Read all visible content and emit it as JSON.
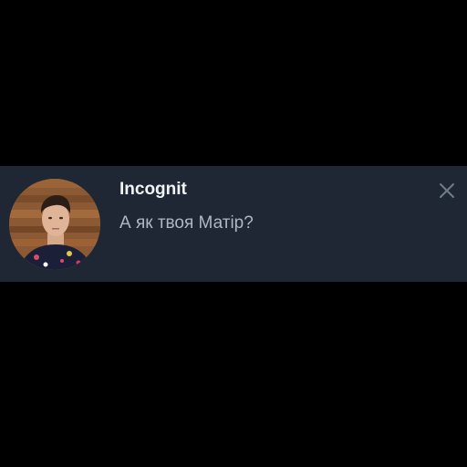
{
  "notification": {
    "sender_name": "Incognit",
    "message_text": "А як твоя Матір?",
    "avatar_icon": "user-photo",
    "close_icon": "close-icon"
  },
  "colors": {
    "background": "#000000",
    "panel": "#1e2733",
    "sender_text": "#f1f3f6",
    "message_text": "#aeb7c2",
    "close_icon": "#6f7b89"
  }
}
